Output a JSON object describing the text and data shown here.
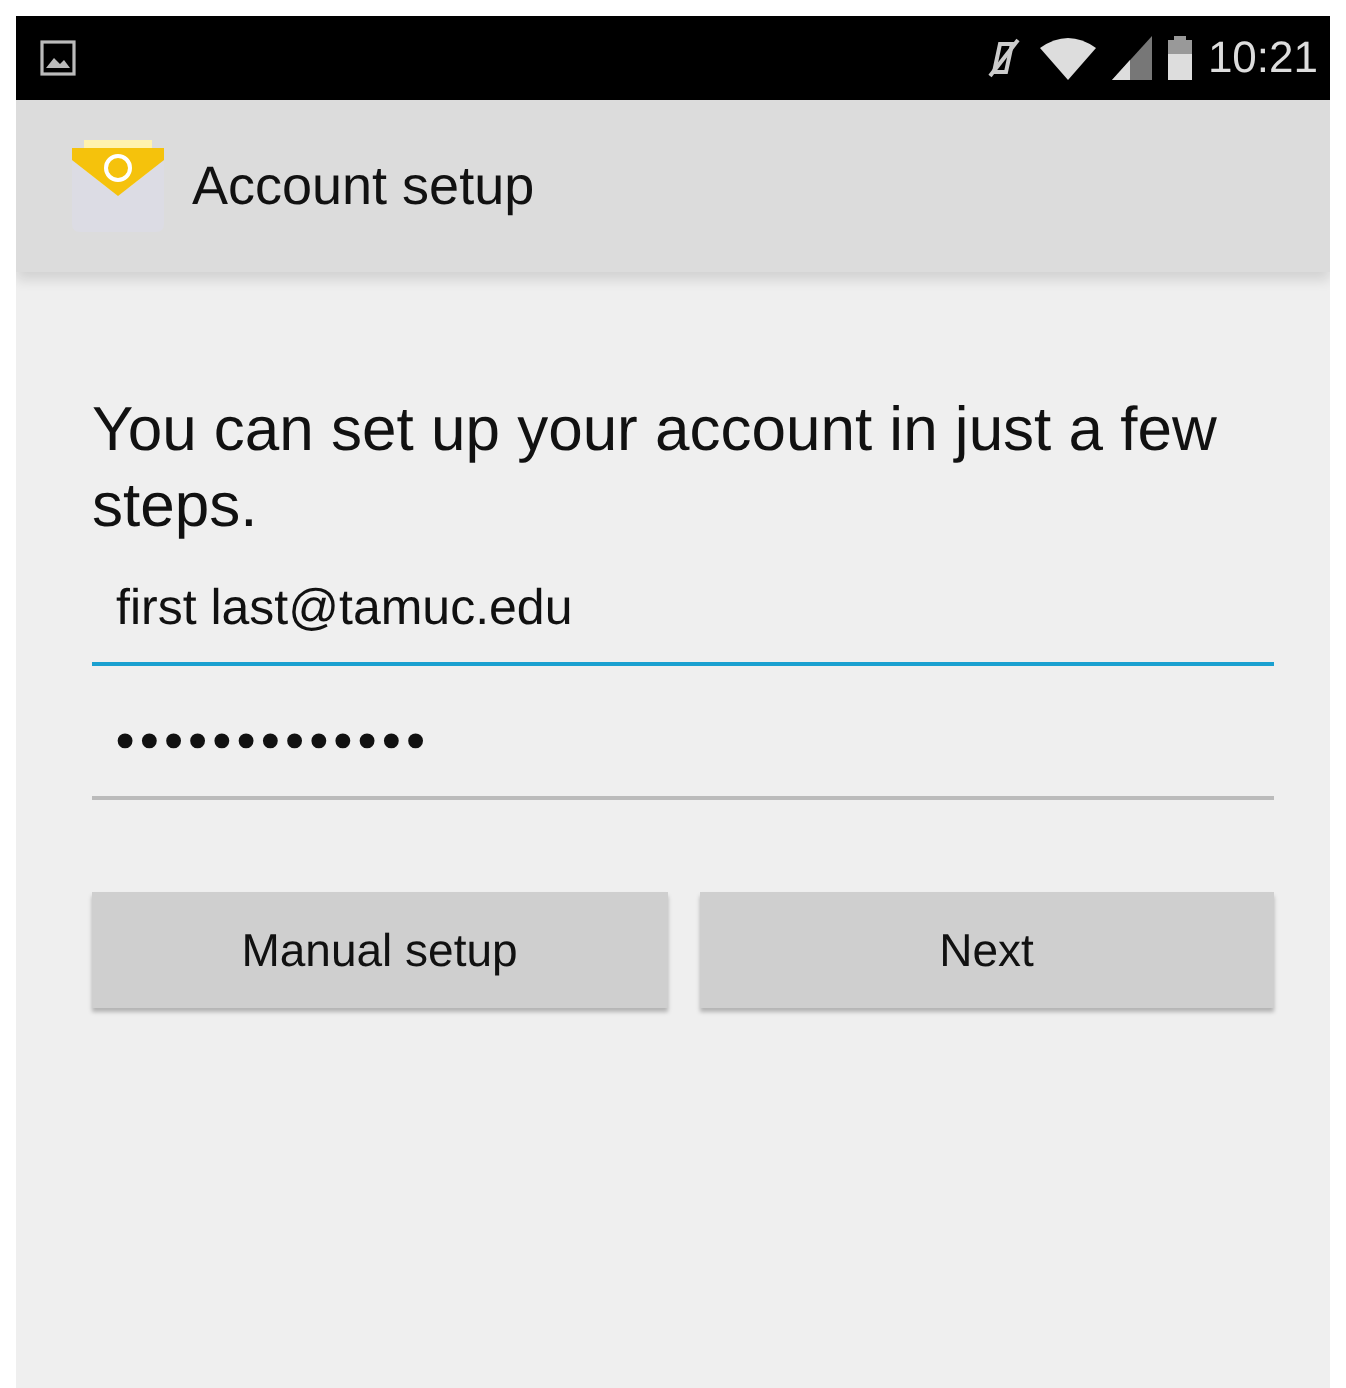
{
  "status_bar": {
    "time": "10:21"
  },
  "action_bar": {
    "title": "Account setup"
  },
  "intro": "You can set up your account in just a few steps.",
  "fields": [
    {
      "kind": "email",
      "value": "first last@tamuc.edu",
      "focused": true
    },
    {
      "kind": "password",
      "value": "•••••••••••••",
      "focused": false
    }
  ],
  "buttons": [
    {
      "label": "Manual setup"
    },
    {
      "label": "Next"
    }
  ]
}
